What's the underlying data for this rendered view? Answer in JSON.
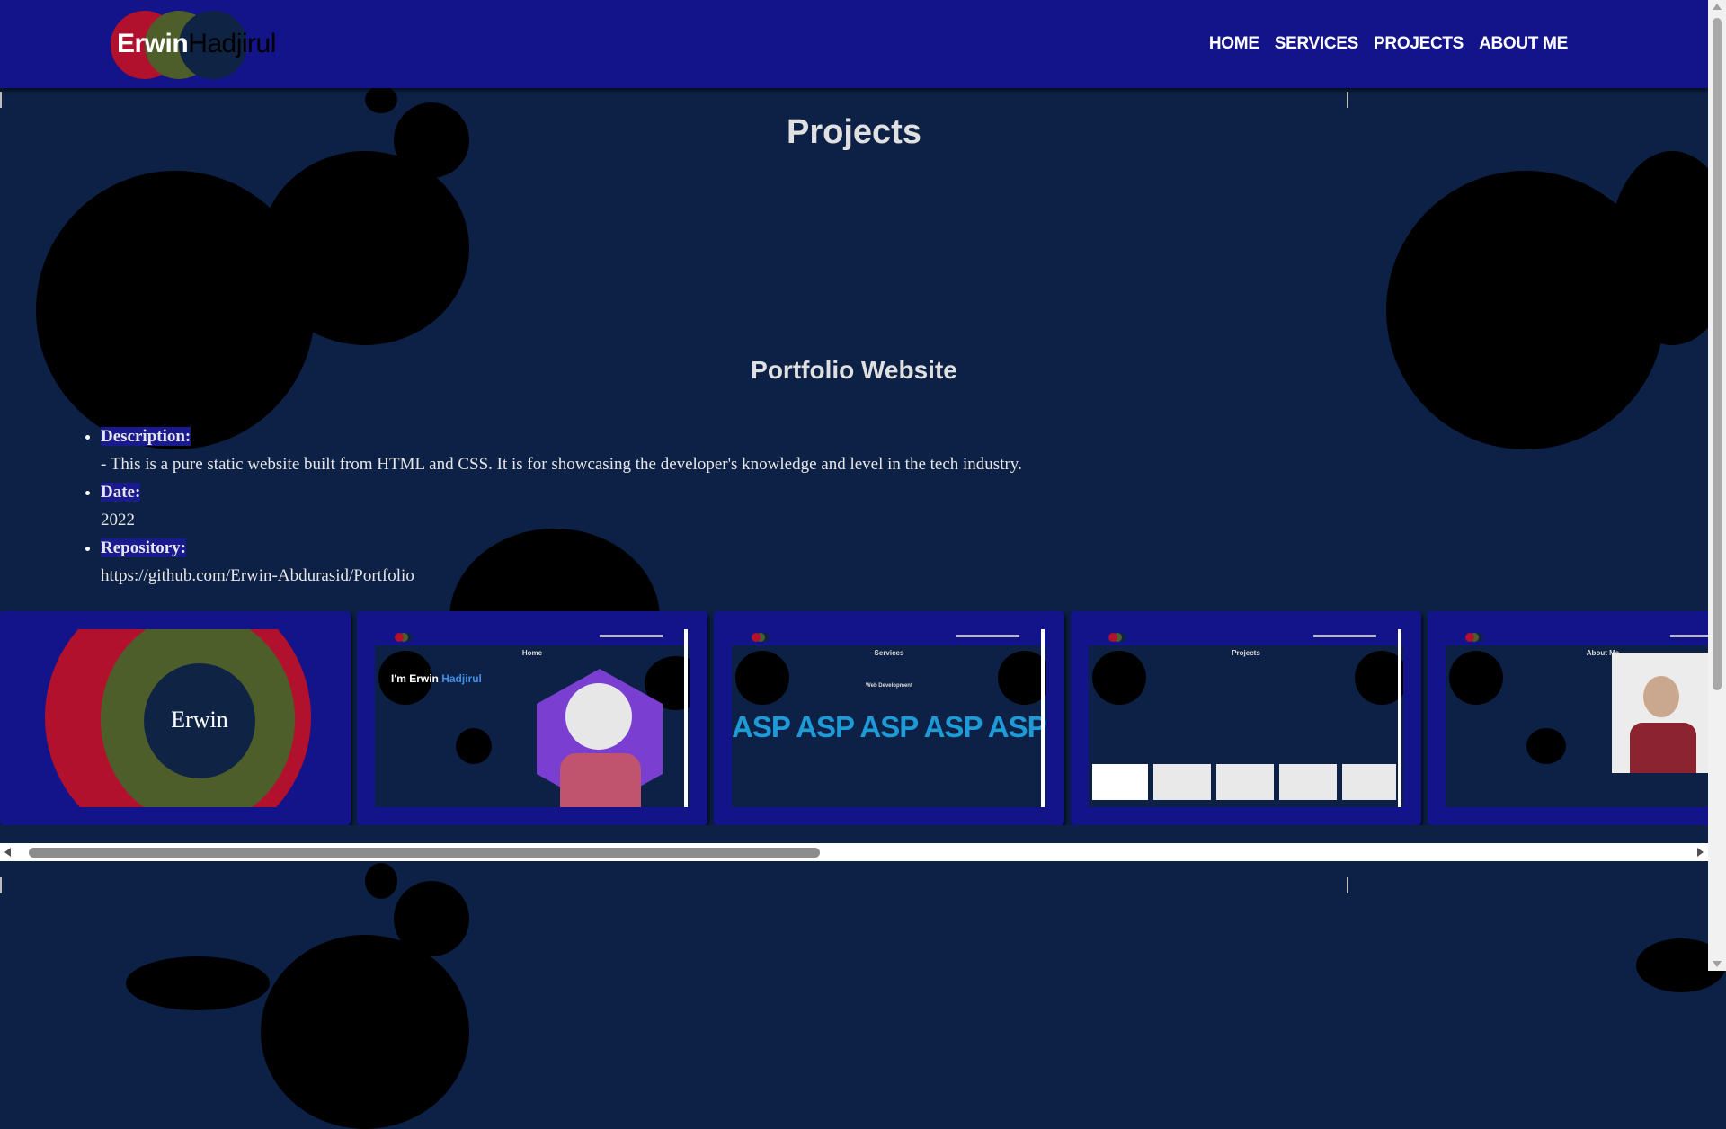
{
  "header": {
    "logo_first": "Erwin",
    "logo_last": "Hadjirul",
    "nav": [
      "HOME",
      "SERVICES",
      "PROJECTS",
      "ABOUT ME"
    ]
  },
  "page_title": "Projects",
  "project": {
    "title": "Portfolio Website",
    "description_label": "Description:",
    "description": "- This is a pure static website built from HTML and CSS. It is for showcasing the developer's knowledge and level in the tech industry.",
    "date_label": "Date:",
    "date": "2022",
    "repository_label": "Repository:",
    "repository": "https://github.com/Erwin-Abdurasid/Portfolio"
  },
  "gallery": {
    "logo_text": "Erwin",
    "shots": [
      {
        "title": "Home",
        "icon": "home-preview"
      },
      {
        "title": "Services",
        "icon": "services-preview"
      },
      {
        "title": "Projects",
        "icon": "projects-preview"
      },
      {
        "title": "About Me",
        "icon": "about-preview"
      }
    ],
    "home_heading": "I'm Erwin",
    "home_heading_accent": "Hadjirul",
    "services_band": "ASP ASP ASP ASP ASP ASP",
    "services_subtitle": "Web Development"
  },
  "colors": {
    "header": "#13138a",
    "background": "#0c2145",
    "logo_red": "#b1112c",
    "logo_green": "#4e5e2b",
    "logo_navy": "#0f2444"
  }
}
